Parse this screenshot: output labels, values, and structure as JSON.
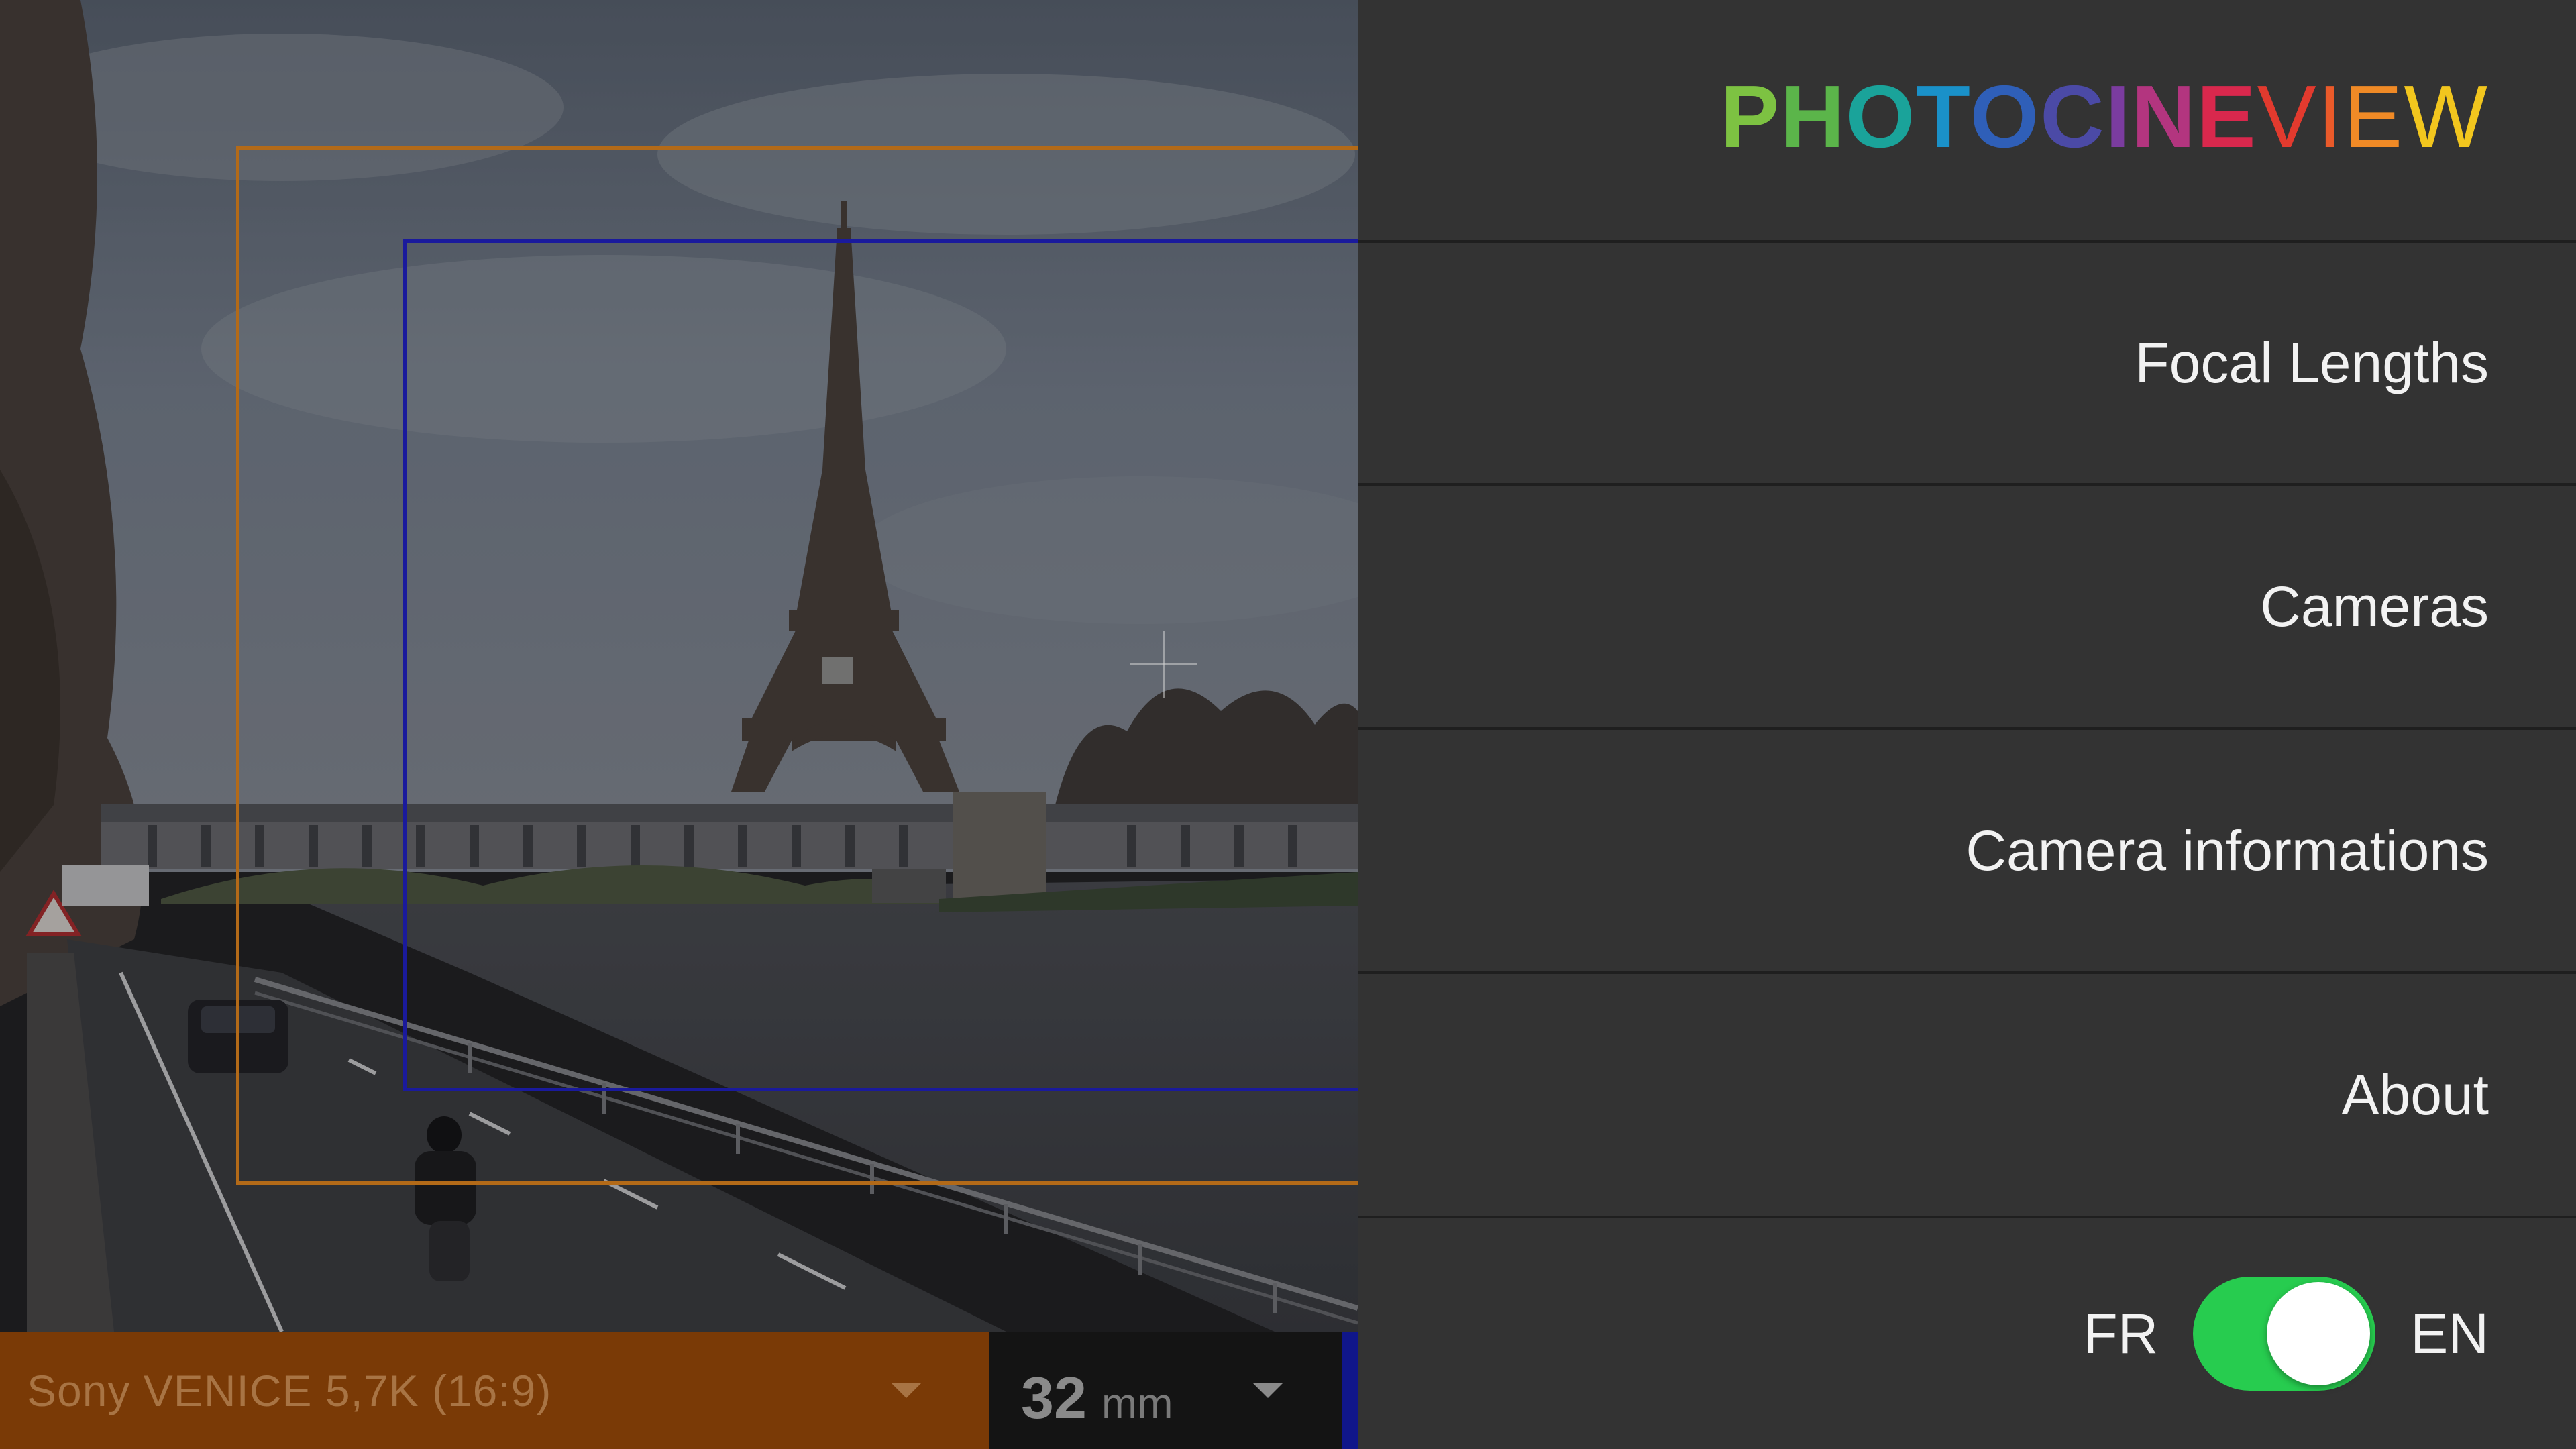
{
  "viewfinder": {
    "camera_select": {
      "label": "Sony VENICE 5,7K (16:9)"
    },
    "focal_select": {
      "value": "32",
      "unit": "mm"
    }
  },
  "menu": {
    "logo": [
      "P",
      "H",
      "O",
      "T",
      "O",
      "C",
      "I",
      "N",
      "E",
      "V",
      "I",
      "E",
      "W"
    ],
    "items": [
      {
        "label": "Focal Lengths"
      },
      {
        "label": "Cameras"
      },
      {
        "label": "Camera informations"
      },
      {
        "label": "About"
      }
    ],
    "language": {
      "left": "FR",
      "right": "EN",
      "selected": "EN"
    }
  },
  "colors": {
    "logo": [
      "#7dc242",
      "#5bb54a",
      "#1aa39a",
      "#1a91c9",
      "#2f5fb8",
      "#4b4aa6",
      "#7b3c9f",
      "#b3357f",
      "#d9284d",
      "#e23a2e",
      "#ea5a2a",
      "#f08a26",
      "#f2c61e"
    ],
    "camera_bar": "#7a3a06",
    "toggle_on": "#27cc4f",
    "frame_outer": "#b36a18",
    "frame_inner": "#1a1a9c"
  }
}
